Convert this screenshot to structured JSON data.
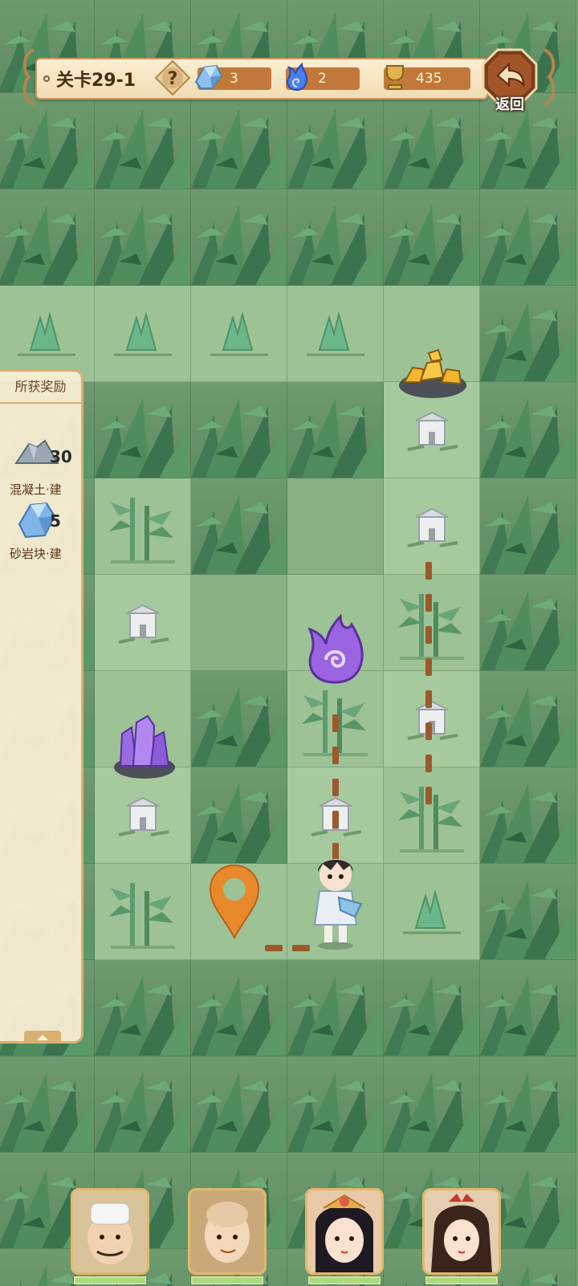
{
  "header": {
    "level": "关卡29-1",
    "help_symbol": "?",
    "resources": [
      {
        "name": "crystal-shard-icon",
        "value": "3",
        "color": "#6fa8d8"
      },
      {
        "name": "blue-flame-icon",
        "value": "2",
        "color": "#3b6fe0"
      },
      {
        "name": "trophy-icon",
        "value": "435",
        "color": "#d9a441"
      }
    ],
    "back_label": "返回"
  },
  "rewards": {
    "title": "所获奖励",
    "items": [
      {
        "icon": "concrete-pile-icon",
        "count": "30",
        "name": "混凝土·建"
      },
      {
        "icon": "sandstone-block-icon",
        "count": "5",
        "name": "砂岩块·建"
      }
    ]
  },
  "map": {
    "tile_types": [
      "fog",
      "open",
      "bamboo",
      "shrine",
      "grass",
      "gold-ore",
      "purple-flame",
      "amethyst",
      "player",
      "waypoint-marker"
    ],
    "objects": [
      {
        "type": "gold-ore",
        "label": "gold-ore-icon"
      },
      {
        "type": "purple-flame",
        "label": "purple-flame-icon"
      },
      {
        "type": "amethyst",
        "label": "amethyst-crystal-icon"
      },
      {
        "type": "player",
        "label": "player-character"
      },
      {
        "type": "waypoint",
        "label": "waypoint-marker-icon"
      }
    ]
  },
  "heroes": [
    {
      "name": "hero-scholar-portrait"
    },
    {
      "name": "hero-monk-portrait"
    },
    {
      "name": "hero-empress-portrait"
    },
    {
      "name": "hero-swordswoman-portrait"
    }
  ],
  "colors": {
    "panel": "#fbeed2",
    "border": "#c99a5a",
    "accent": "#c27838",
    "fog": "#6e9a70",
    "open": "#9cc295",
    "path": "#9a5a2c",
    "marker": "#e8892c"
  }
}
